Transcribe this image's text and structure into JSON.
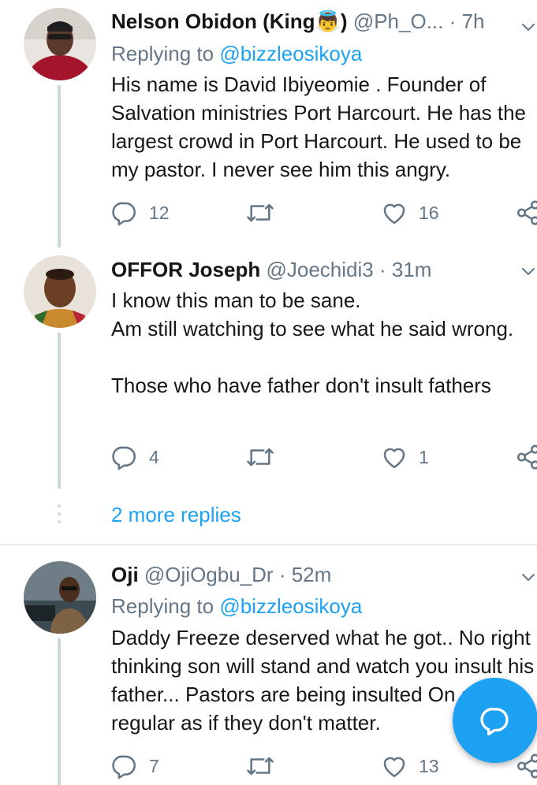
{
  "tweets": [
    {
      "name": "Nelson Obidon (King",
      "name_emoji": "👼",
      "name_close": ")",
      "handle": "@Ph_O...",
      "dot": "·",
      "time": "7h",
      "replying_label": "Replying to ",
      "replying_mention": "@bizzleosikoya",
      "text": "His name is David Ibiyeomie  . Founder of Salvation ministries Port Harcourt. He has the largest crowd in Port Harcourt. He used to be my pastor. I never see him this angry.",
      "replies": "12",
      "retweets": "",
      "likes": "16"
    },
    {
      "name": "OFFOR Joseph",
      "handle": "@Joechidi3",
      "dot": "·",
      "time": "31m",
      "text": "I know this man to be sane.\nAm still watching to see what he said wrong.\n\nThose who have father don't insult fathers",
      "replies": "4",
      "retweets": "",
      "likes": "1"
    },
    {
      "name": "Oji",
      "handle": "@OjiOgbu_Dr",
      "dot": "·",
      "time": "52m",
      "replying_label": "Replying to ",
      "replying_mention": "@bizzleosikoya",
      "text": "Daddy Freeze deserved what he got..  No right thinking son will stand and watch you insult his father... Pastors are being insulted On a regular as if they don't matter.",
      "replies": "7",
      "retweets": "",
      "likes": "13"
    }
  ],
  "more_replies": "2 more replies",
  "colors": {
    "accent": "#1da1f2",
    "secondary_text": "#657786",
    "thread_line": "#ccd6dd",
    "divider": "#e6ecf0"
  },
  "icons": {
    "reply": "speech-bubble-icon",
    "retweet": "retweet-icon",
    "like": "heart-icon",
    "share": "share-icon",
    "menu": "chevron-down-icon",
    "compose": "compose-reply-icon"
  }
}
